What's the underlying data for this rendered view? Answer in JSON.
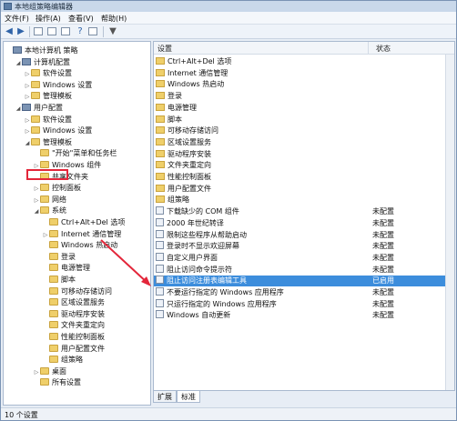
{
  "window": {
    "title": "本地组策略编辑器"
  },
  "menu": [
    "文件(F)",
    "操作(A)",
    "查看(V)",
    "帮助(H)"
  ],
  "tree": [
    {
      "label": "本地计算机 策略",
      "indent": 0,
      "icon": "computer",
      "exp": ""
    },
    {
      "label": "计算机配置",
      "indent": 1,
      "icon": "computer",
      "exp": "◢"
    },
    {
      "label": "软件设置",
      "indent": 2,
      "icon": "folder",
      "exp": "▷"
    },
    {
      "label": "Windows 设置",
      "indent": 2,
      "icon": "folder",
      "exp": "▷"
    },
    {
      "label": "管理模板",
      "indent": 2,
      "icon": "folder",
      "exp": "▷"
    },
    {
      "label": "用户配置",
      "indent": 1,
      "icon": "computer",
      "exp": "◢"
    },
    {
      "label": "软件设置",
      "indent": 2,
      "icon": "folder",
      "exp": "▷"
    },
    {
      "label": "Windows 设置",
      "indent": 2,
      "icon": "folder",
      "exp": "▷"
    },
    {
      "label": "管理模板",
      "indent": 2,
      "icon": "folder",
      "exp": "◢"
    },
    {
      "label": "\"开始\"菜单和任务栏",
      "indent": 3,
      "icon": "folder",
      "exp": ""
    },
    {
      "label": "Windows 组件",
      "indent": 3,
      "icon": "folder",
      "exp": "▷"
    },
    {
      "label": "共享文件夹",
      "indent": 3,
      "icon": "folder",
      "exp": ""
    },
    {
      "label": "控制面板",
      "indent": 3,
      "icon": "folder",
      "exp": "▷"
    },
    {
      "label": "网络",
      "indent": 3,
      "icon": "folder",
      "exp": "▷"
    },
    {
      "label": "系统",
      "indent": 3,
      "icon": "folder",
      "exp": "◢"
    },
    {
      "label": "Ctrl+Alt+Del 选项",
      "indent": 4,
      "icon": "folder",
      "exp": ""
    },
    {
      "label": "Internet 通信管理",
      "indent": 4,
      "icon": "folder",
      "exp": "▷"
    },
    {
      "label": "Windows 热启动",
      "indent": 4,
      "icon": "folder",
      "exp": ""
    },
    {
      "label": "登录",
      "indent": 4,
      "icon": "folder",
      "exp": ""
    },
    {
      "label": "电源管理",
      "indent": 4,
      "icon": "folder",
      "exp": ""
    },
    {
      "label": "脚本",
      "indent": 4,
      "icon": "folder",
      "exp": ""
    },
    {
      "label": "可移动存储访问",
      "indent": 4,
      "icon": "folder",
      "exp": ""
    },
    {
      "label": "区域设置服务",
      "indent": 4,
      "icon": "folder",
      "exp": ""
    },
    {
      "label": "驱动程序安装",
      "indent": 4,
      "icon": "folder",
      "exp": ""
    },
    {
      "label": "文件夹重定向",
      "indent": 4,
      "icon": "folder",
      "exp": ""
    },
    {
      "label": "性能控制面板",
      "indent": 4,
      "icon": "folder",
      "exp": ""
    },
    {
      "label": "用户配置文件",
      "indent": 4,
      "icon": "folder",
      "exp": ""
    },
    {
      "label": "组策略",
      "indent": 4,
      "icon": "folder",
      "exp": ""
    },
    {
      "label": "桌面",
      "indent": 3,
      "icon": "folder",
      "exp": "▷"
    },
    {
      "label": "所有设置",
      "indent": 3,
      "icon": "folder",
      "exp": ""
    }
  ],
  "right": {
    "col_setting": "设置",
    "col_status": "状态",
    "rows": [
      {
        "name": "Ctrl+Alt+Del 选项",
        "status": "",
        "icon": "folder"
      },
      {
        "name": "Internet 通信管理",
        "status": "",
        "icon": "folder"
      },
      {
        "name": "Windows 热启动",
        "status": "",
        "icon": "folder"
      },
      {
        "name": "登录",
        "status": "",
        "icon": "folder"
      },
      {
        "name": "电源管理",
        "status": "",
        "icon": "folder"
      },
      {
        "name": "脚本",
        "status": "",
        "icon": "folder"
      },
      {
        "name": "可移动存储访问",
        "status": "",
        "icon": "folder"
      },
      {
        "name": "区域设置服务",
        "status": "",
        "icon": "folder"
      },
      {
        "name": "驱动程序安装",
        "status": "",
        "icon": "folder"
      },
      {
        "name": "文件夹重定向",
        "status": "",
        "icon": "folder"
      },
      {
        "name": "性能控制面板",
        "status": "",
        "icon": "folder"
      },
      {
        "name": "用户配置文件",
        "status": "",
        "icon": "folder"
      },
      {
        "name": "组策略",
        "status": "",
        "icon": "folder"
      },
      {
        "name": "下载缺少的 COM 组件",
        "status": "未配置",
        "icon": "policy"
      },
      {
        "name": "2000 年世纪转译",
        "status": "未配置",
        "icon": "policy"
      },
      {
        "name": "限制这些程序从帮助启动",
        "status": "未配置",
        "icon": "policy"
      },
      {
        "name": "登录时不显示欢迎屏幕",
        "status": "未配置",
        "icon": "policy"
      },
      {
        "name": "自定义用户界面",
        "status": "未配置",
        "icon": "policy"
      },
      {
        "name": "阻止访问命令提示符",
        "status": "未配置",
        "icon": "policy"
      },
      {
        "name": "阻止访问注册表编辑工具",
        "status": "已启用",
        "icon": "policy",
        "selected": true
      },
      {
        "name": "不要运行指定的 Windows 应用程序",
        "status": "未配置",
        "icon": "policy"
      },
      {
        "name": "只运行指定的 Windows 应用程序",
        "status": "未配置",
        "icon": "policy"
      },
      {
        "name": "Windows 自动更新",
        "status": "未配置",
        "icon": "policy"
      }
    ]
  },
  "tabs": [
    "扩展",
    "标准"
  ],
  "status": "10 个设置",
  "colors": {
    "selection": "#3c8ddc",
    "highlight_box": "#e3263a",
    "arrow": "#e3263a"
  }
}
